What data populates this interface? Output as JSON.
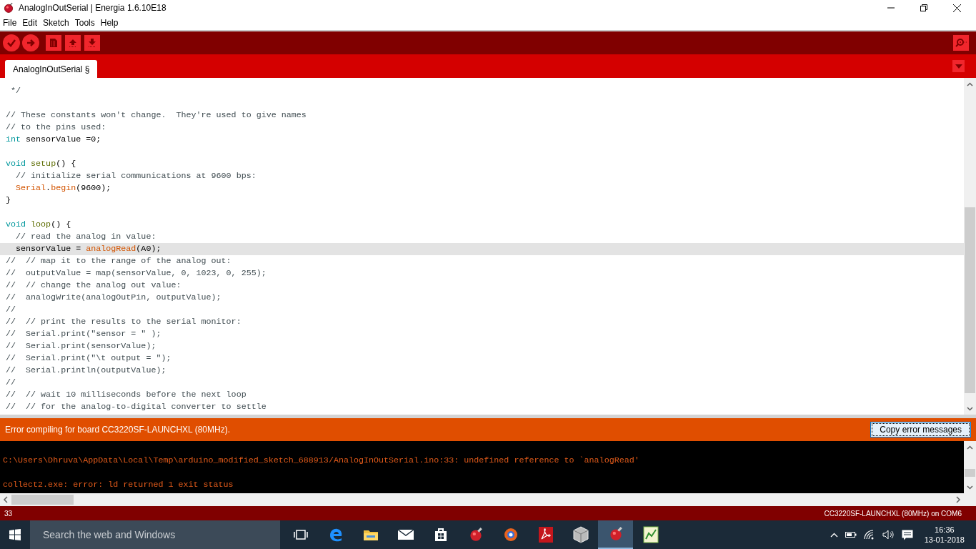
{
  "window": {
    "title": "AnalogInOutSerial | Energia 1.6.10E18"
  },
  "menu": [
    "File",
    "Edit",
    "Sketch",
    "Tools",
    "Help"
  ],
  "tabs": [
    {
      "label": "AnalogInOutSerial §",
      "selected": true
    }
  ],
  "editor": {
    "lines": [
      {
        "highlighted": false,
        "tokens": [
          {
            "kind": "comment",
            "text": " */"
          }
        ]
      },
      {
        "highlighted": false
      },
      {
        "highlighted": false,
        "tokens": [
          {
            "kind": "comment",
            "text": "// These constants won't change.  They're used to give names"
          }
        ]
      },
      {
        "highlighted": false,
        "tokens": [
          {
            "kind": "comment",
            "text": "// to the pins used:"
          }
        ]
      },
      {
        "highlighted": false,
        "tokens": [
          {
            "kind": "keyword",
            "text": "int"
          },
          {
            "kind": "plain",
            "text": " sensorValue =0;"
          }
        ]
      },
      {
        "highlighted": false
      },
      {
        "highlighted": false,
        "tokens": [
          {
            "kind": "keyword",
            "text": "void "
          },
          {
            "kind": "function",
            "text": "setup"
          },
          {
            "kind": "plain",
            "text": "() {"
          }
        ]
      },
      {
        "highlighted": false,
        "tokens": [
          {
            "kind": "comment",
            "text": "  // initialize serial communications at 9600 bps:"
          }
        ]
      },
      {
        "highlighted": false,
        "tokens": [
          {
            "kind": "builtin",
            "text": "  Serial"
          },
          {
            "kind": "plain",
            "text": "."
          },
          {
            "kind": "builtin",
            "text": "begin"
          },
          {
            "kind": "plain",
            "text": "(9600);"
          }
        ]
      },
      {
        "highlighted": false,
        "tokens": [
          {
            "kind": "plain",
            "text": "}"
          }
        ]
      },
      {
        "highlighted": false
      },
      {
        "highlighted": false,
        "tokens": [
          {
            "kind": "keyword",
            "text": "void "
          },
          {
            "kind": "function",
            "text": "loop"
          },
          {
            "kind": "plain",
            "text": "() {"
          }
        ]
      },
      {
        "highlighted": false,
        "tokens": [
          {
            "kind": "comment",
            "text": "  // read the analog in value:"
          }
        ]
      },
      {
        "highlighted": true,
        "tokens": [
          {
            "kind": "plain",
            "text": "  sensorValue = "
          },
          {
            "kind": "builtin",
            "text": "analogRead"
          },
          {
            "kind": "plain",
            "text": "(A0);"
          }
        ]
      },
      {
        "highlighted": false,
        "tokens": [
          {
            "kind": "comment",
            "text": "//  // map it to the range of the analog out:"
          }
        ]
      },
      {
        "highlighted": false,
        "tokens": [
          {
            "kind": "comment",
            "text": "//  outputValue = map(sensorValue, 0, 1023, 0, 255);"
          }
        ]
      },
      {
        "highlighted": false,
        "tokens": [
          {
            "kind": "comment",
            "text": "//  // change the analog out value:"
          }
        ]
      },
      {
        "highlighted": false,
        "tokens": [
          {
            "kind": "comment",
            "text": "//  analogWrite(analogOutPin, outputValue);"
          }
        ]
      },
      {
        "highlighted": false,
        "tokens": [
          {
            "kind": "comment",
            "text": "//"
          }
        ]
      },
      {
        "highlighted": false,
        "tokens": [
          {
            "kind": "comment",
            "text": "//  // print the results to the serial monitor:"
          }
        ]
      },
      {
        "highlighted": false,
        "tokens": [
          {
            "kind": "comment",
            "text": "//  Serial.print(\"sensor = \" );"
          }
        ]
      },
      {
        "highlighted": false,
        "tokens": [
          {
            "kind": "comment",
            "text": "//  Serial.print(sensorValue);"
          }
        ]
      },
      {
        "highlighted": false,
        "tokens": [
          {
            "kind": "comment",
            "text": "//  Serial.print(\"\\t output = \");"
          }
        ]
      },
      {
        "highlighted": false,
        "tokens": [
          {
            "kind": "comment",
            "text": "//  Serial.println(outputValue);"
          }
        ]
      },
      {
        "highlighted": false,
        "tokens": [
          {
            "kind": "comment",
            "text": "//"
          }
        ]
      },
      {
        "highlighted": false,
        "tokens": [
          {
            "kind": "comment",
            "text": "//  // wait 10 milliseconds before the next loop"
          }
        ]
      },
      {
        "highlighted": false,
        "tokens": [
          {
            "kind": "comment",
            "text": "//  // for the analog-to-digital converter to settle"
          }
        ]
      }
    ]
  },
  "error_bar": {
    "message": "Error compiling for board CC3220SF-LAUNCHXL (80MHz).",
    "button": "Copy error messages"
  },
  "console": {
    "lines": [
      "C:\\Users\\Dhruva\\AppData\\Local\\Temp\\arduino_modified_sketch_688913/AnalogInOutSerial.ino:33: undefined reference to `analogRead'",
      "collect2.exe: error: ld returned 1 exit status"
    ]
  },
  "status_bar": {
    "line": "33",
    "board": "CC3220SF-LAUNCHXL (80MHz) on COM6"
  },
  "taskbar": {
    "search": {
      "placeholder": "Search the web and Windows"
    },
    "apps": [
      {
        "kind": "taskview",
        "selected": false
      },
      {
        "kind": "edge",
        "selected": false
      },
      {
        "kind": "folder",
        "selected": false
      },
      {
        "kind": "mail",
        "selected": false
      },
      {
        "kind": "store",
        "selected": false
      },
      {
        "kind": "energia",
        "selected": false
      },
      {
        "kind": "browser",
        "selected": false
      },
      {
        "kind": "pdf",
        "selected": false
      },
      {
        "kind": "cube",
        "selected": false
      },
      {
        "kind": "energia",
        "selected": true
      },
      {
        "kind": "chart",
        "selected": false
      }
    ],
    "clock": {
      "time": "16:36",
      "date": "13-01-2018"
    }
  }
}
